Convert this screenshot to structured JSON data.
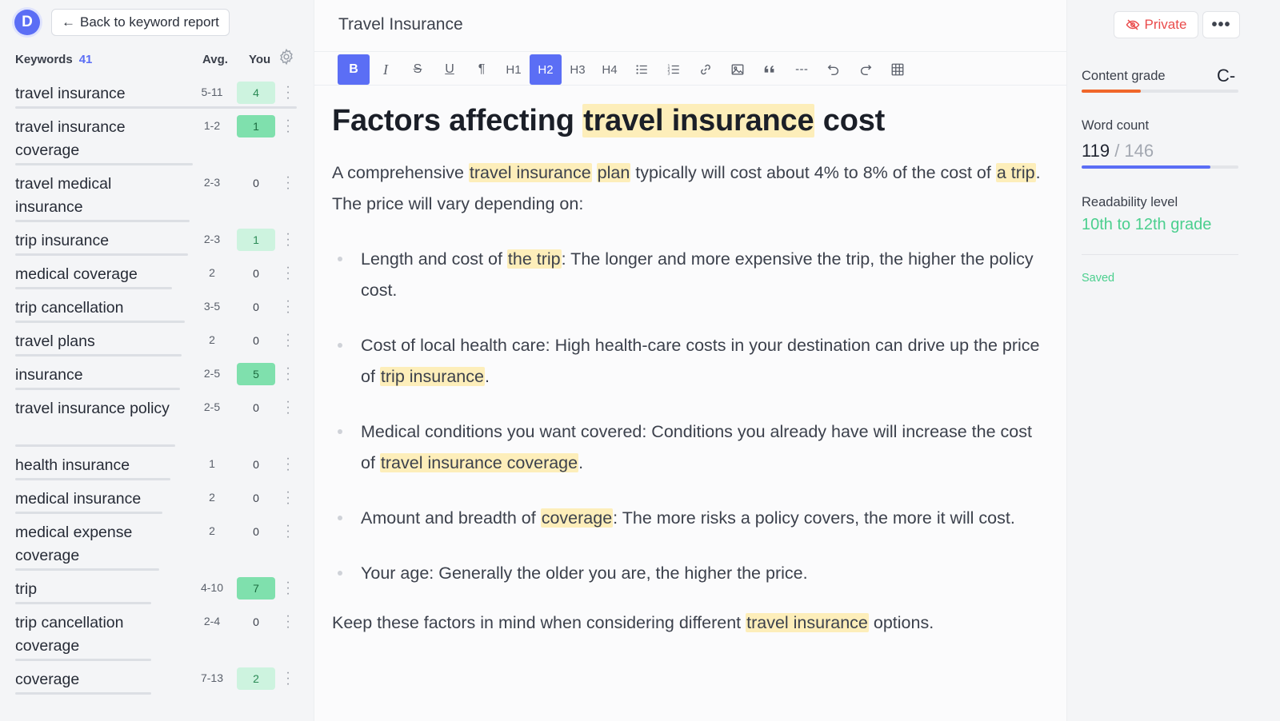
{
  "sidebar": {
    "logo_letter": "D",
    "back_label": "Back to keyword report",
    "header": {
      "title": "Keywords",
      "count": "41",
      "avg": "Avg.",
      "you": "You"
    },
    "keywords": [
      {
        "name": "travel insurance",
        "avg": "5-11",
        "you": "4",
        "style": "lightgreen"
      },
      {
        "name": "travel insurance coverage",
        "avg": "1-2",
        "you": "1",
        "style": "green"
      },
      {
        "name": "travel medical insurance",
        "avg": "2-3",
        "you": "0",
        "style": ""
      },
      {
        "name": "trip insurance",
        "avg": "2-3",
        "you": "1",
        "style": "lightgreen"
      },
      {
        "name": "medical coverage",
        "avg": "2",
        "you": "0",
        "style": ""
      },
      {
        "name": "trip cancellation",
        "avg": "3-5",
        "you": "0",
        "style": ""
      },
      {
        "name": "travel plans",
        "avg": "2",
        "you": "0",
        "style": ""
      },
      {
        "name": "insurance",
        "avg": "2-5",
        "you": "5",
        "style": "green"
      },
      {
        "name": "travel insurance policy",
        "avg": "2-5",
        "you": "0",
        "style": ""
      },
      {
        "name": "health insurance",
        "avg": "1",
        "you": "0",
        "style": ""
      },
      {
        "name": "medical insurance",
        "avg": "2",
        "you": "0",
        "style": ""
      },
      {
        "name": "medical expense coverage",
        "avg": "2",
        "you": "0",
        "style": ""
      },
      {
        "name": "trip",
        "avg": "4-10",
        "you": "7",
        "style": "green"
      },
      {
        "name": "trip cancellation coverage",
        "avg": "2-4",
        "you": "0",
        "style": ""
      },
      {
        "name": "coverage",
        "avg": "7-13",
        "you": "2",
        "style": "lightgreen"
      }
    ]
  },
  "editor": {
    "title": "Travel Insurance",
    "toolbar": [
      {
        "label": "B",
        "name": "bold-button",
        "active": true
      },
      {
        "label": "I",
        "name": "italic-button",
        "active": false
      },
      {
        "label": "S",
        "name": "strikethrough-button",
        "active": false
      },
      {
        "label": "U",
        "name": "underline-button",
        "active": false
      },
      {
        "label": "¶",
        "name": "paragraph-button",
        "active": false
      },
      {
        "label": "H1",
        "name": "heading1-button",
        "active": false
      },
      {
        "label": "H2",
        "name": "heading2-button",
        "active": true
      },
      {
        "label": "H3",
        "name": "heading3-button",
        "active": false
      },
      {
        "label": "H4",
        "name": "heading4-button",
        "active": false
      },
      {
        "label": "bullets",
        "name": "bulleted-list-button",
        "active": false
      },
      {
        "label": "numbers",
        "name": "numbered-list-button",
        "active": false
      },
      {
        "label": "link",
        "name": "link-button",
        "active": false
      },
      {
        "label": "image",
        "name": "image-button",
        "active": false
      },
      {
        "label": "quote",
        "name": "quote-button",
        "active": false
      },
      {
        "label": "hr",
        "name": "horizontal-rule-button",
        "active": false
      },
      {
        "label": "undo",
        "name": "undo-button",
        "active": false
      },
      {
        "label": "redo",
        "name": "redo-button",
        "active": false
      },
      {
        "label": "table",
        "name": "table-button",
        "active": false
      }
    ],
    "heading": [
      {
        "t": "Factors affecting ",
        "h": false
      },
      {
        "t": "travel insurance",
        "h": true
      },
      {
        "t": " cost",
        "h": false
      }
    ],
    "intro": [
      {
        "t": "A comprehensive ",
        "h": false
      },
      {
        "t": "travel insurance",
        "h": true
      },
      {
        "t": " ",
        "h": false
      },
      {
        "t": "plan",
        "h": true
      },
      {
        "t": " typically will cost about 4% to 8% of the cost of ",
        "h": false
      },
      {
        "t": "a trip",
        "h": true
      },
      {
        "t": ". The price will vary depending on:",
        "h": false
      }
    ],
    "bullets": [
      [
        {
          "t": "Length and cost of ",
          "h": false
        },
        {
          "t": "the trip",
          "h": true
        },
        {
          "t": ": The longer and more expensive the trip, the higher the policy cost.",
          "h": false
        }
      ],
      [
        {
          "t": "Cost of local health care: High health-care costs in your destination can drive up the price of ",
          "h": false
        },
        {
          "t": "trip insurance",
          "h": true
        },
        {
          "t": ".",
          "h": false
        }
      ],
      [
        {
          "t": "Medical conditions you want covered: Conditions you already have will increase the cost of ",
          "h": false
        },
        {
          "t": "travel insurance coverage",
          "h": true
        },
        {
          "t": ".",
          "h": false
        }
      ],
      [
        {
          "t": "Amount and breadth of ",
          "h": false
        },
        {
          "t": "coverage",
          "h": true
        },
        {
          "t": ": The more risks a policy covers, the more it will cost.",
          "h": false
        }
      ],
      [
        {
          "t": "Your age: Generally the older you are, the higher the price.",
          "h": false
        }
      ]
    ],
    "closing": [
      {
        "t": "Keep these factors in mind when considering different ",
        "h": false
      },
      {
        "t": "travel insurance",
        "h": true
      },
      {
        "t": " options.",
        "h": false
      }
    ]
  },
  "right": {
    "private_label": "Private",
    "more_label": "•••",
    "content_grade_label": "Content grade",
    "content_grade": "C-",
    "content_grade_progress": 0.38,
    "word_count_label": "Word count",
    "word_count": "119",
    "word_count_target": "/ 146",
    "word_count_progress": 0.82,
    "readability_label": "Readability level",
    "readability": "10th to 12th grade",
    "saved_label": "Saved",
    "colors": {
      "accent": "#5b6ef5",
      "grade_bar": "#f0662a",
      "green": "#4bcf8e",
      "private": "#ea4b4b"
    }
  }
}
